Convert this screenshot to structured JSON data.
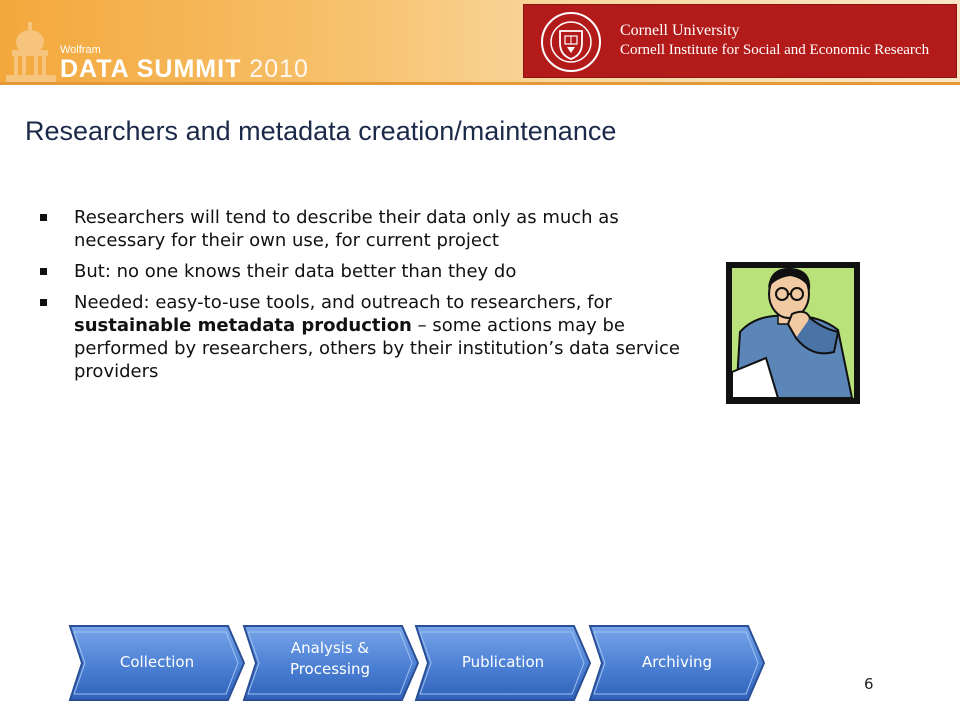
{
  "header": {
    "wolfram": "Wolfram",
    "summit_name": "DATA SUMMIT",
    "summit_year": "2010",
    "cornell_university": "Cornell University",
    "cornell_institute": "Cornell Institute for Social and Economic Research"
  },
  "slide": {
    "title": "Researchers and metadata creation/maintenance",
    "bullets": [
      {
        "text": "Researchers will tend to describe their data only as much as necessary for their own use, for current project"
      },
      {
        "text": "But: no one knows their data better than they do"
      },
      {
        "pre": "Needed: easy-to-use tools, and outreach to researchers, for ",
        "bold": "sustainable metadata production",
        "post": " – some actions may be performed by researchers, others by their institution’s data service providers"
      }
    ],
    "flow": [
      "Collection",
      "Analysis & Processing",
      "Publication",
      "Archiving"
    ],
    "page_number": "6"
  },
  "colors": {
    "banner": "#f3a83c",
    "cornell_red": "#b31b1b",
    "title": "#1c2a4a",
    "flow_blue": "#4a7fd4"
  }
}
